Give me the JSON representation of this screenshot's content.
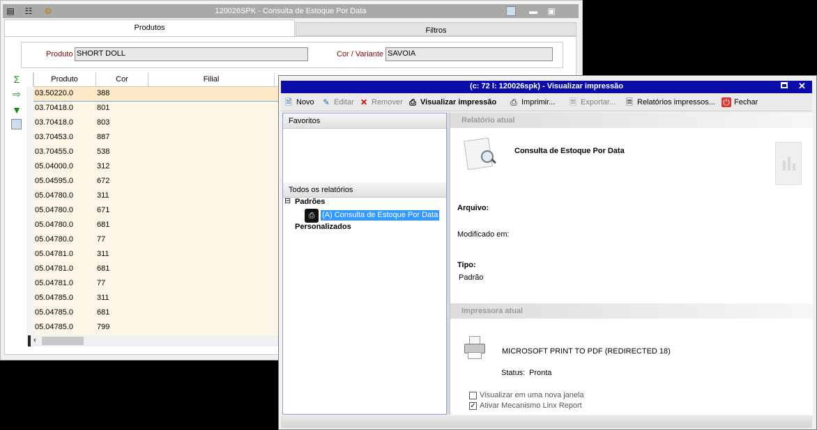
{
  "back_window": {
    "title": "120026SPK - Consulta de Estoque Por Data",
    "tabs": [
      "Produtos",
      "Filtros"
    ],
    "filter": {
      "produto_label": "Produto",
      "produto_value": "SHORT DOLL",
      "cor_label": "Cor / Variante",
      "cor_value": "SAVOIA"
    },
    "grid": {
      "columns": [
        "Produto",
        "Cor",
        "Filial"
      ],
      "rows": [
        {
          "produto": "03.50220.0",
          "cor": "388"
        },
        {
          "produto": "03.70418.0",
          "cor": "801"
        },
        {
          "produto": "03.70418.0",
          "cor": "803"
        },
        {
          "produto": "03.70453.0",
          "cor": "887"
        },
        {
          "produto": "03.70455.0",
          "cor": "538"
        },
        {
          "produto": "05.04000.0",
          "cor": "312"
        },
        {
          "produto": "05.04595.0",
          "cor": "672"
        },
        {
          "produto": "05.04780.0",
          "cor": "311"
        },
        {
          "produto": "05.04780.0",
          "cor": "671"
        },
        {
          "produto": "05.04780.0",
          "cor": "681"
        },
        {
          "produto": "05.04780.0",
          "cor": "77"
        },
        {
          "produto": "05.04781.0",
          "cor": "311"
        },
        {
          "produto": "05.04781.0",
          "cor": "681"
        },
        {
          "produto": "05.04781.0",
          "cor": "77"
        },
        {
          "produto": "05.04785.0",
          "cor": "311"
        },
        {
          "produto": "05.04785.0",
          "cor": "681"
        },
        {
          "produto": "05.04785.0",
          "cor": "799"
        }
      ]
    }
  },
  "dialog": {
    "title": "(c: 72 l: 120026spk) - Visualizar impressão",
    "toolbar": {
      "novo": "Novo",
      "editar": "Editar",
      "remover": "Remover",
      "visualizar": "Visualizar impressão",
      "imprimir": "Imprimir...",
      "exportar": "Exportar...",
      "relatorios": "Relatórios impressos...",
      "fechar": "Fechar"
    },
    "favoritos": "Favoritos",
    "todos": "Todos os relatórios",
    "tree": {
      "padroes": "Padrões",
      "item": "(A) Consulta de Estoque Por Data",
      "personalizados": "Personalizados",
      "expander": "⊟"
    },
    "relatorio_atual": "Relatório atual",
    "report_name": "Consulta de Estoque Por Data",
    "arquivo_label": "Arquivo:",
    "modificado_label": "Modificado em:",
    "tipo_label": "Tipo:",
    "tipo_value": "Padrão",
    "impressora_atual": "Impressora atual",
    "printer_name": "MICROSOFT PRINT TO PDF (REDIRECTED 18)",
    "status_label": "Status:",
    "status_value": "Pronta",
    "opt1": "Visualizar em uma nova janela",
    "opt2": "Ativar Mecanismo Linx Report"
  },
  "colors": {
    "dialog_title_bg": "#0c0ca8",
    "row_highlight": "#fde8c8",
    "row_bg": "#fdf5e6",
    "selected_item": "#3399ff",
    "label_red": "#8b0000"
  }
}
